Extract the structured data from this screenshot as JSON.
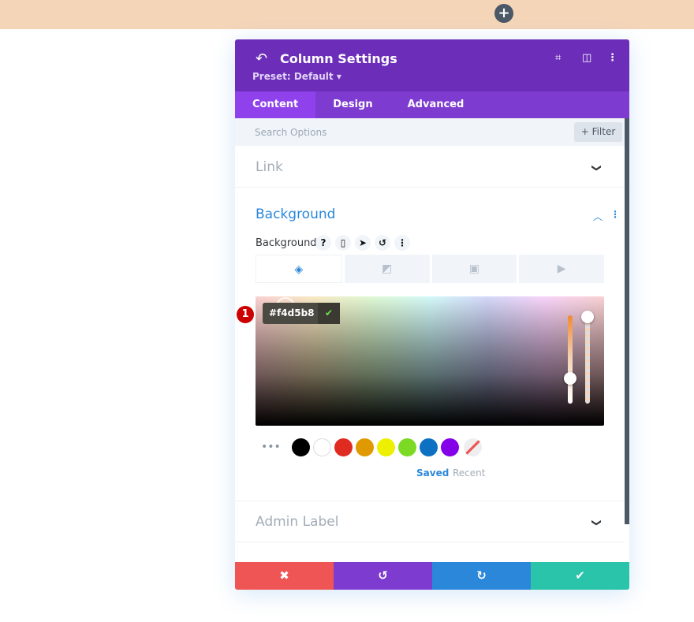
{
  "topbar": {
    "color": "#f4d5b8",
    "add_icon": "plus-icon",
    "add_label": "+"
  },
  "header": {
    "title": "Column Settings",
    "preset": "Preset: Default ▾",
    "back_glyph": "↶",
    "icons": [
      "focus-icon",
      "columns-layout-icon",
      "more-vertical-icon"
    ],
    "color": "#6c2eb9"
  },
  "tabs": [
    {
      "label": "Content",
      "active": true
    },
    {
      "label": "Design"
    },
    {
      "label": "Advanced"
    }
  ],
  "search": {
    "placeholder": "Search Options",
    "filter_label": "+ Filter"
  },
  "sections": {
    "link": "Link",
    "background": "Background",
    "admin_label": "Admin Label"
  },
  "background": {
    "label": "Background",
    "option_icons": [
      "?",
      "▯",
      "➤",
      "↺",
      "⋮"
    ],
    "type_tabs": [
      "color-icon",
      "gradient-icon",
      "image-icon",
      "video-icon"
    ],
    "hex_value": "#f4d5b8",
    "badge": "1",
    "swatches": [
      "#000000",
      "#ffffff",
      "#e02b20",
      "#e09900",
      "#edf000",
      "#7cda24",
      "#0c71c3",
      "#8300e9"
    ],
    "saved_label": "Saved",
    "recent_label": "Recent"
  },
  "footer": {
    "cancel": "✖",
    "undo": "↺",
    "redo": "↻",
    "save": "✔",
    "colors": [
      "#ef5555",
      "#7e3bd0",
      "#2b87da",
      "#29c4a9"
    ]
  }
}
